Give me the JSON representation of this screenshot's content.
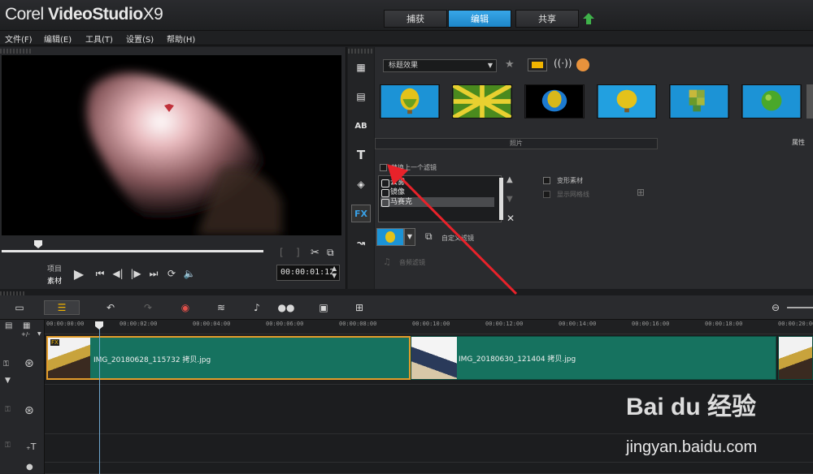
{
  "title_bar": {
    "brand": "Corel",
    "product": "VideoStudio",
    "version": "X9"
  },
  "top_tabs": [
    {
      "label": "捕获",
      "active": false
    },
    {
      "label": "编辑",
      "active": true
    },
    {
      "label": "共享",
      "active": false
    }
  ],
  "menu": [
    "文件(F)",
    "编辑(E)",
    "工具(T)",
    "设置(S)",
    "帮助(H)"
  ],
  "preview": {
    "mode_project": "项目",
    "mode_clip": "素材",
    "timecode": "00:00:01:12"
  },
  "library": {
    "filter_dropdown": "标题效果",
    "tab_photo": "照片",
    "tab_attributes": "属性",
    "replace_last_filter": "替换上一个滤镜",
    "filters": [
      {
        "label": "云雾",
        "selected": false
      },
      {
        "label": "镜像",
        "selected": false
      },
      {
        "label": "马赛克",
        "selected": true
      }
    ],
    "transform_clip": "变形素材",
    "show_grid": "显示网格线",
    "custom_filter": "自定义滤镜",
    "audio_filter": "音频滤镜"
  },
  "ruler": {
    "ticks": [
      "00:00:00:00",
      "00:00:02:00",
      "00:00:04:00",
      "00:00:06:00",
      "00:00:08:00",
      "00:00:10:00",
      "00:00:12:00",
      "00:00:14:00",
      "00:00:16:00",
      "00:00:18:00",
      "00:00:20:00"
    ]
  },
  "track_controls": {
    "add_remove": "+/-"
  },
  "clips": [
    {
      "name": "IMG_20180628_115732 拷贝.jpg",
      "badge": "FX"
    },
    {
      "name": "IMG_20180630_121404 拷贝.jpg"
    }
  ],
  "watermark": {
    "logo": "Bai du 经验",
    "url": "jingyan.baidu.com"
  },
  "colors": {
    "accent": "#2196d8",
    "clip": "#16725f",
    "clip_selected_border": "#e39c2b",
    "arrow": "#e8222a"
  }
}
